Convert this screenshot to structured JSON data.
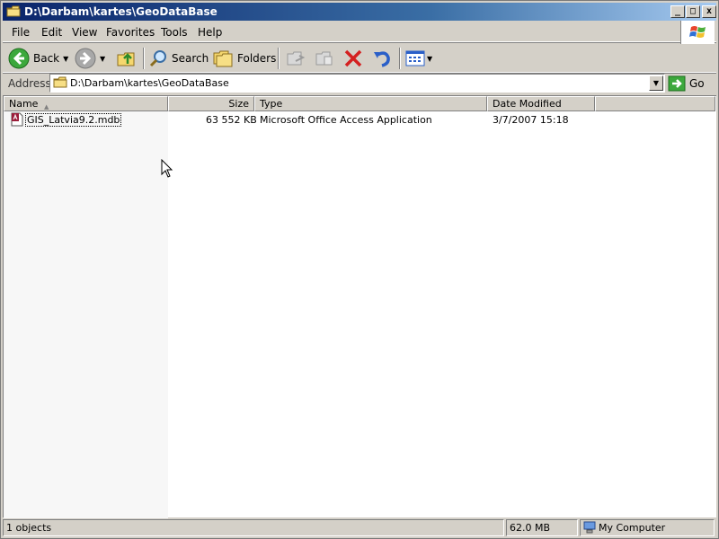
{
  "window": {
    "title": "D:\\Darbam\\kartes\\GeoDataBase",
    "minimize": "_",
    "maximize": "□",
    "close": "x"
  },
  "menu": [
    {
      "label": "File"
    },
    {
      "label": "Edit"
    },
    {
      "label": "View"
    },
    {
      "label": "Favorites"
    },
    {
      "label": "Tools"
    },
    {
      "label": "Help"
    }
  ],
  "toolbar": {
    "back_label": "Back",
    "search_label": "Search",
    "folders_label": "Folders"
  },
  "address": {
    "label": "Address",
    "value": "D:\\Darbam\\kartes\\GeoDataBase",
    "go_label": "Go"
  },
  "columns": {
    "name": "Name",
    "size": "Size",
    "type": "Type",
    "date": "Date Modified"
  },
  "files": [
    {
      "name": "GIS_Latvia9.2.mdb",
      "size": "63 552 KB",
      "type": "Microsoft Office Access Application",
      "date": "3/7/2007 15:18"
    }
  ],
  "status": {
    "objects": "1 objects",
    "size": "62.0 MB",
    "location": "My Computer"
  },
  "colors": {
    "title_start": "#0a246a",
    "title_end": "#a6caf0",
    "face": "#d4d0c8"
  }
}
